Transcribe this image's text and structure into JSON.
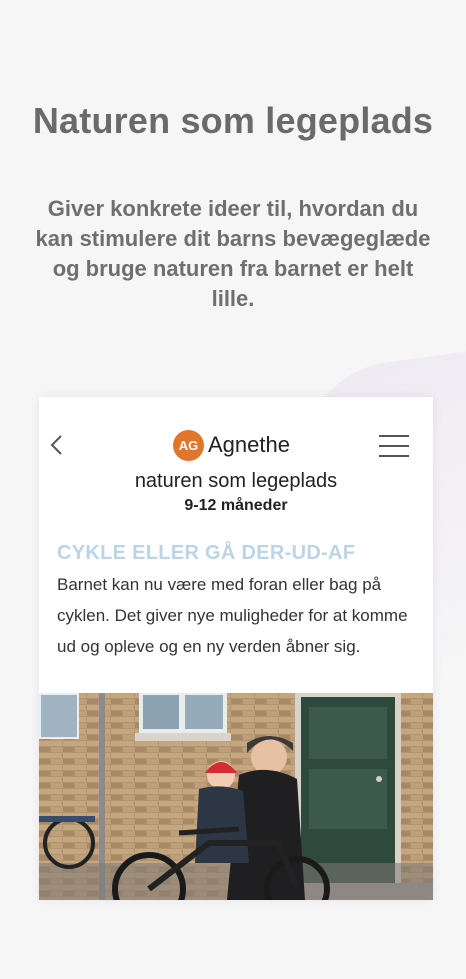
{
  "promo": {
    "headline": "Naturen som legeplads",
    "subtext": "Giver konkrete ideer til, hvordan du kan stimulere dit barns bevægeglæde og bruge naturen fra barnet er helt lille."
  },
  "app": {
    "brand_initials": "AG",
    "brand_name": "Agnethe",
    "back_icon": "chevron-left-icon",
    "menu_icon": "hamburger-menu-icon",
    "page_title": "naturen som legeplads",
    "page_subtitle": "9-12 måneder",
    "section_title": "CYKLE ELLER GÅ DER-UD-AF",
    "body": "Barnet kan nu være med foran eller bag på cyklen. Det giver nye muligheder for at komme ud og opleve og en ny verden åbner sig."
  },
  "colors": {
    "background": "#f6f6f7",
    "headline": "#6a6a6a",
    "brand_badge": "#e0762a",
    "section_title": "#bcd5e6"
  }
}
